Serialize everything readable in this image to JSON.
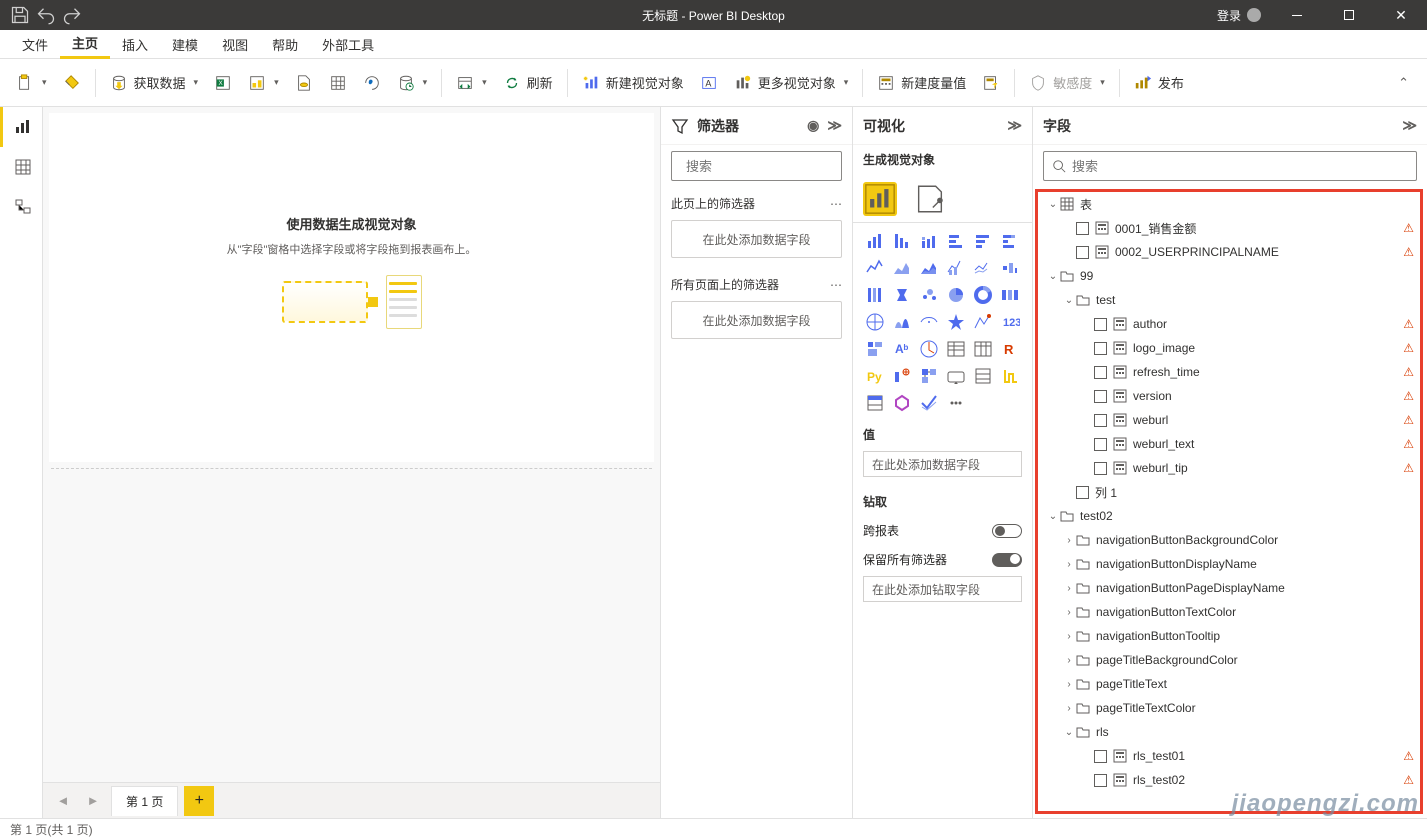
{
  "titlebar": {
    "title": "无标题 - Power BI Desktop",
    "login": "登录"
  },
  "menu": {
    "file": "文件",
    "home": "主页",
    "insert": "插入",
    "modeling": "建模",
    "view": "视图",
    "help": "帮助",
    "external": "外部工具"
  },
  "ribbon": {
    "getdata": "获取数据",
    "refresh": "刷新",
    "newvisual": "新建视觉对象",
    "morevisuals": "更多视觉对象",
    "newmeasure": "新建度量值",
    "sensitivity": "敏感度",
    "publish": "发布"
  },
  "canvas": {
    "heading": "使用数据生成视觉对象",
    "sub": "从\"字段\"窗格中选择字段或将字段拖到报表画布上。"
  },
  "tabs": {
    "page1": "第 1 页"
  },
  "filters": {
    "title": "筛选器",
    "search": "搜索",
    "sec1": "此页上的筛选器",
    "drop": "在此处添加数据字段",
    "sec2": "所有页面上的筛选器"
  },
  "viz": {
    "title": "可视化",
    "subtitle": "生成视觉对象",
    "values": "值",
    "valuedrop": "在此处添加数据字段",
    "drill": "钻取",
    "cross": "跨报表",
    "keep": "保留所有筛选器",
    "drilldrop": "在此处添加钻取字段"
  },
  "fields": {
    "title": "字段",
    "search": "搜索",
    "tree": [
      {
        "lvl": 0,
        "t": "node",
        "label": "表",
        "icon": "table",
        "exp": "open"
      },
      {
        "lvl": 1,
        "t": "leaf",
        "label": "0001_销售金额",
        "icon": "measure",
        "warn": true
      },
      {
        "lvl": 1,
        "t": "leaf",
        "label": "0002_USERPRINCIPALNAME",
        "icon": "measure",
        "warn": true
      },
      {
        "lvl": 0,
        "t": "node",
        "label": "99",
        "icon": "folder",
        "exp": "open"
      },
      {
        "lvl": 1,
        "t": "node",
        "label": "test",
        "icon": "folder",
        "exp": "open"
      },
      {
        "lvl": 2,
        "t": "leaf",
        "label": "author",
        "icon": "measure",
        "warn": true
      },
      {
        "lvl": 2,
        "t": "leaf",
        "label": "logo_image",
        "icon": "measure",
        "warn": true
      },
      {
        "lvl": 2,
        "t": "leaf",
        "label": "refresh_time",
        "icon": "measure",
        "warn": true
      },
      {
        "lvl": 2,
        "t": "leaf",
        "label": "version",
        "icon": "measure",
        "warn": true
      },
      {
        "lvl": 2,
        "t": "leaf",
        "label": "weburl",
        "icon": "measure",
        "warn": true
      },
      {
        "lvl": 2,
        "t": "leaf",
        "label": "weburl_text",
        "icon": "measure",
        "warn": true
      },
      {
        "lvl": 2,
        "t": "leaf",
        "label": "weburl_tip",
        "icon": "measure",
        "warn": true
      },
      {
        "lvl": 1,
        "t": "leaf",
        "label": "列 1",
        "icon": "none",
        "warn": false
      },
      {
        "lvl": 0,
        "t": "node",
        "label": "test02",
        "icon": "folder",
        "exp": "open"
      },
      {
        "lvl": 1,
        "t": "node",
        "label": "navigationButtonBackgroundColor",
        "icon": "folder",
        "exp": "closed"
      },
      {
        "lvl": 1,
        "t": "node",
        "label": "navigationButtonDisplayName",
        "icon": "folder",
        "exp": "closed"
      },
      {
        "lvl": 1,
        "t": "node",
        "label": "navigationButtonPageDisplayName",
        "icon": "folder",
        "exp": "closed"
      },
      {
        "lvl": 1,
        "t": "node",
        "label": "navigationButtonTextColor",
        "icon": "folder",
        "exp": "closed"
      },
      {
        "lvl": 1,
        "t": "node",
        "label": "navigationButtonTooltip",
        "icon": "folder",
        "exp": "closed"
      },
      {
        "lvl": 1,
        "t": "node",
        "label": "pageTitleBackgroundColor",
        "icon": "folder",
        "exp": "closed"
      },
      {
        "lvl": 1,
        "t": "node",
        "label": "pageTitleText",
        "icon": "folder",
        "exp": "closed"
      },
      {
        "lvl": 1,
        "t": "node",
        "label": "pageTitleTextColor",
        "icon": "folder",
        "exp": "closed"
      },
      {
        "lvl": 1,
        "t": "node",
        "label": "rls",
        "icon": "folder",
        "exp": "open"
      },
      {
        "lvl": 2,
        "t": "leaf",
        "label": "rls_test01",
        "icon": "measure",
        "warn": true
      },
      {
        "lvl": 2,
        "t": "leaf",
        "label": "rls_test02",
        "icon": "measure",
        "warn": true
      }
    ]
  },
  "status": {
    "text": "第 1 页(共 1 页)"
  },
  "watermark": "jiaopengzi.com"
}
